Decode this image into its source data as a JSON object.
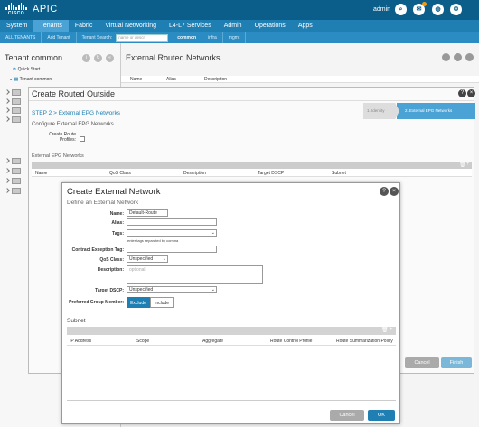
{
  "topbar": {
    "logo_text": "CISCO",
    "app_title": "APIC",
    "user": "admin",
    "icons": [
      "search-icon",
      "alerts-icon",
      "help-icon",
      "settings-icon"
    ]
  },
  "mainnav": {
    "items": [
      "System",
      "Tenants",
      "Fabric",
      "Virtual Networking",
      "L4-L7 Services",
      "Admin",
      "Operations",
      "Apps"
    ],
    "active": "Tenants"
  },
  "subnav": {
    "items": [
      "ALL TENANTS",
      "Add Tenant",
      "Tenant Search:"
    ],
    "search_placeholder": "name or descr",
    "tenants": [
      "common",
      "infra",
      "mgmt"
    ]
  },
  "left_pane": {
    "title": "Tenant common",
    "quick_start": "Quick Start",
    "tree_root": "Tenant common"
  },
  "right_pane": {
    "title": "External Routed Networks",
    "columns": [
      "Name",
      "Alias",
      "Description"
    ]
  },
  "routed_outside": {
    "title": "Create Routed Outside",
    "step_label": "STEP 2 > External EPG Networks",
    "step_sub": "Configure External EPG Networks",
    "wizard": [
      "1. Identity",
      "2. External EPG Networks"
    ],
    "create_route_profiles_label": "Create Route Profiles:",
    "ext_epg_label": "External EPG Networks",
    "ext_columns": [
      "Name",
      "QoS Class",
      "Description",
      "Target DSCP",
      "Subnet"
    ],
    "cancel_label": "Cancel",
    "finish_label": "Finish"
  },
  "external_network": {
    "title": "Create External Network",
    "subtitle": "Define an External Network",
    "fields": {
      "name_label": "Name:",
      "name_value": "Default-Route",
      "alias_label": "Alias:",
      "alias_value": "",
      "tags_label": "Tags:",
      "tags_value": "",
      "tags_hint": "enter tags separated by comma",
      "contract_label": "Contract Exception Tag:",
      "contract_value": "",
      "qos_label": "QoS Class:",
      "qos_value": "Unspecified",
      "description_label": "Description:",
      "description_placeholder": "optional",
      "dscp_label": "Target DSCP:",
      "dscp_value": "Unspecified",
      "pgm_label": "Preferred Group Member:",
      "pgm_exclude": "Exclude",
      "pgm_include": "Include"
    },
    "subnet": {
      "title": "Subnet",
      "columns": [
        "IP Address",
        "Scope",
        "Aggregate",
        "Route Control Profile",
        "Route Summarization Policy"
      ]
    },
    "cancel_label": "Cancel",
    "ok_label": "OK"
  },
  "colors": {
    "topbar": "#0b5e8a",
    "nav": "#1f7fb3",
    "accent": "#4aa3d4"
  }
}
